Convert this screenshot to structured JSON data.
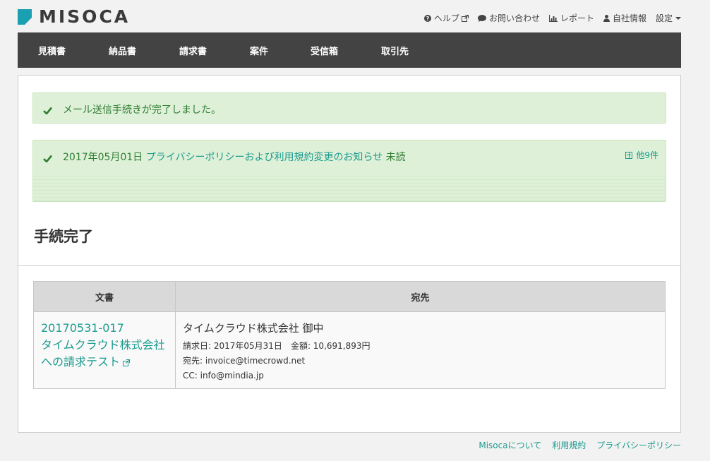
{
  "brand": {
    "name": "MISOCA",
    "accent": "#1aa0b0"
  },
  "top_links": [
    {
      "icon": "help-icon",
      "label": "ヘルプ",
      "external": true
    },
    {
      "icon": "chat-icon",
      "label": "お問い合わせ"
    },
    {
      "icon": "bar-chart-icon",
      "label": "レポート"
    },
    {
      "icon": "user-icon",
      "label": "自社情報"
    },
    {
      "icon": "",
      "label": "設定",
      "dropdown": true
    }
  ],
  "nav": [
    "見積書",
    "納品書",
    "請求書",
    "案件",
    "受信箱",
    "取引先"
  ],
  "alerts": {
    "success": "メール送信手続きが完了しました。",
    "news": {
      "date": "2017年05月01日",
      "title": "プライバシーポリシーおよび利用規約変更のお知らせ",
      "status": "未読",
      "more": "他9件"
    }
  },
  "page_title": "手続完了",
  "table": {
    "headers": [
      "文書",
      "宛先"
    ],
    "row": {
      "doc_number": "20170531-017",
      "doc_title_1": "タイムクラウド株式会社",
      "doc_title_2": "への請求テスト",
      "recipient": "タイムクラウド株式会社 御中",
      "invoice_date": "請求日: 2017年05月31日",
      "amount": "金額: 10,691,893円",
      "to": "宛先: invoice@timecrowd.net",
      "cc": "CC: info@mindia.jp"
    }
  },
  "footer": [
    "Misocaについて",
    "利用規約",
    "プライバシーポリシー"
  ]
}
